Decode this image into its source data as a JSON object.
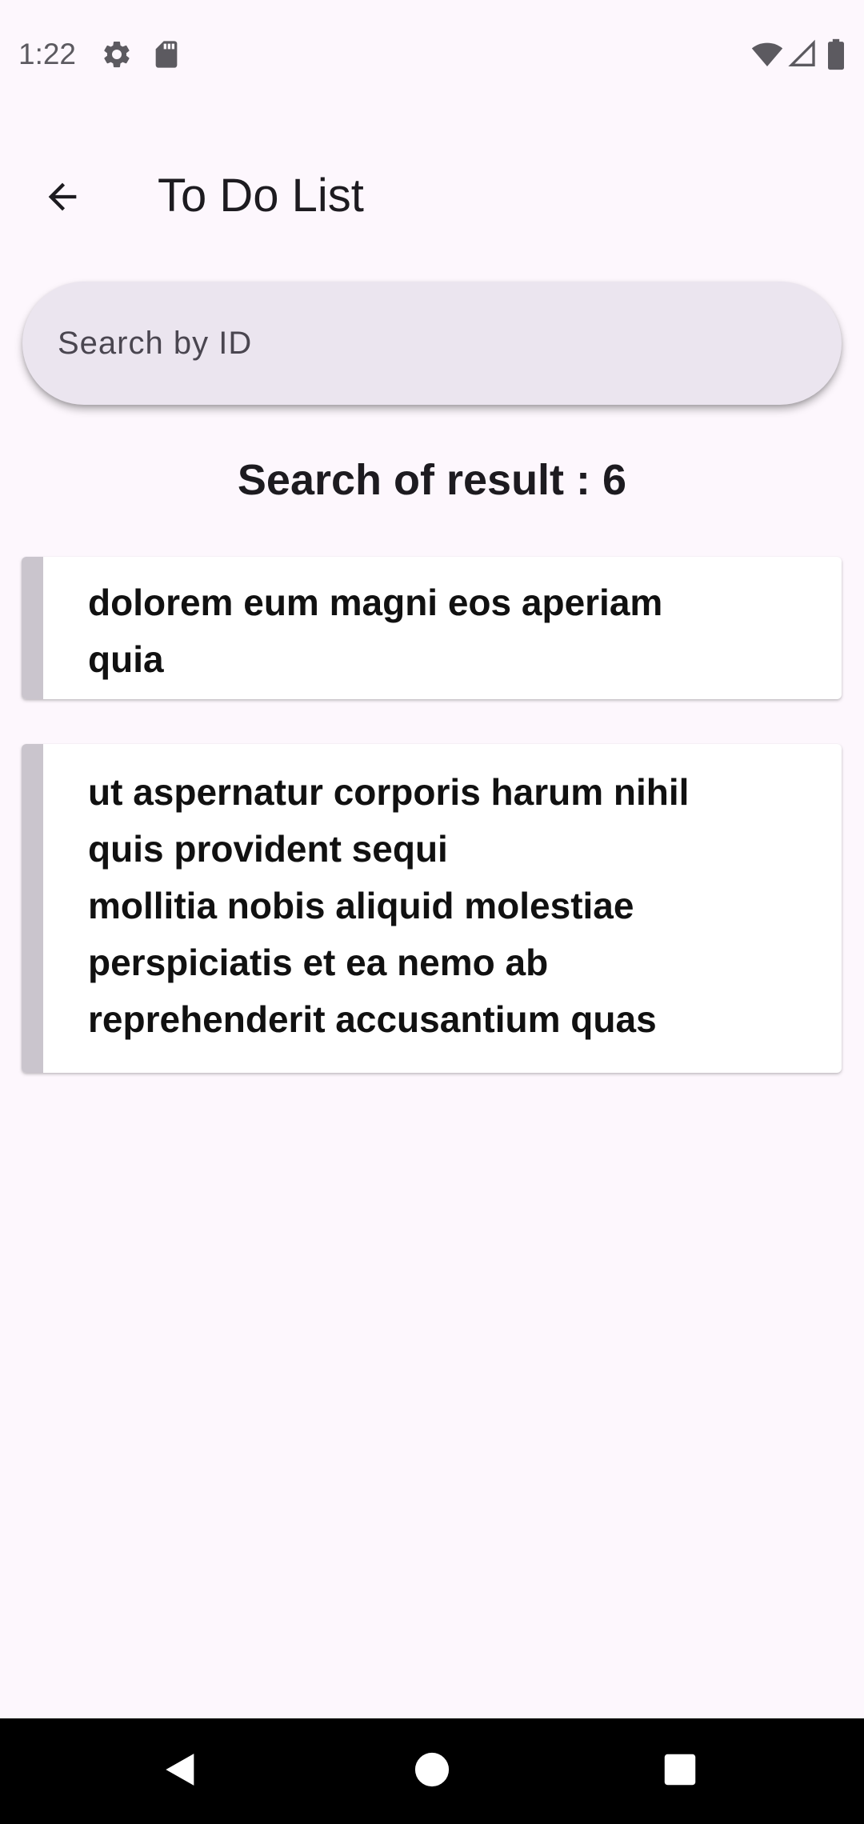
{
  "status_bar": {
    "time": "1:22",
    "left_icons": [
      "gear-icon",
      "sd-card-icon"
    ],
    "right_icons": [
      "wifi-icon",
      "signal-icon",
      "battery-icon"
    ]
  },
  "app_bar": {
    "back_icon": "arrow-left-icon",
    "title": "To Do List"
  },
  "search": {
    "placeholder": "Search by ID",
    "value": ""
  },
  "result_count_text": "Search of result : 6",
  "results": [
    {
      "text": "dolorem eum magni eos aperiam quia"
    },
    {
      "text": "ut aspernatur corporis harum nihil quis provident sequi\nmollitia nobis aliquid molestiae perspiciatis et ea nemo ab reprehenderit accusantium quas"
    }
  ],
  "nav_bar": {
    "buttons": [
      "back-triangle-icon",
      "home-circle-icon",
      "recents-square-icon"
    ]
  },
  "colors": {
    "background": "#fdf7fd",
    "search_fill": "#ebe5ef",
    "card_accent": "#cac5cd",
    "nav_bar": "#000000"
  }
}
